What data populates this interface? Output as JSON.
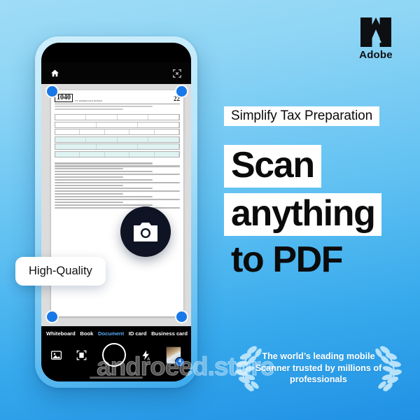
{
  "brand": {
    "name": "Adobe",
    "logo_icon": "adobe-a-mark",
    "accent_blue": "#1878e8",
    "bg_top": "#9fdcf6",
    "bg_bottom": "#2091e4"
  },
  "copy": {
    "tagline": "Simplify Tax Preparation",
    "headline_line1": "Scan",
    "headline_line2": "anything",
    "headline_line3": "to PDF"
  },
  "badges": {
    "quality_pill": "High-Quality",
    "camera_icon": "camera-icon"
  },
  "award": {
    "line1": "The world’s leading mobile",
    "line2": "Scanner trusted by millions of",
    "line3": "professionals",
    "left_icon": "laurel-branch-left-icon",
    "right_icon": "laurel-branch-right-icon"
  },
  "watermark": {
    "text": "androeed.store"
  },
  "phone": {
    "topbar": {
      "home_icon": "home-icon",
      "crop_icon": "crop-expand-icon"
    },
    "document": {
      "form_number": "1040",
      "form_subtitle": "Department of the Treasury—Internal Revenue Service",
      "form_title": "U.S. Individual Income Tax Return",
      "form_year": "22",
      "corner_handle_icon": "corner-handle-dot"
    },
    "modes": [
      {
        "label": "Whiteboard",
        "active": false
      },
      {
        "label": "Book",
        "active": false
      },
      {
        "label": "Document",
        "active": true
      },
      {
        "label": "ID card",
        "active": false
      },
      {
        "label": "Business card",
        "active": false
      }
    ],
    "controls": {
      "gallery_icon": "gallery-image-icon",
      "autocapture_icon": "document-detect-icon",
      "shutter_icon": "shutter-button",
      "flash_icon": "flash-auto-icon",
      "thumbnail_icon": "last-capture-thumbnail",
      "thumbnail_count": "4",
      "home_indicator": "home-indicator"
    }
  }
}
